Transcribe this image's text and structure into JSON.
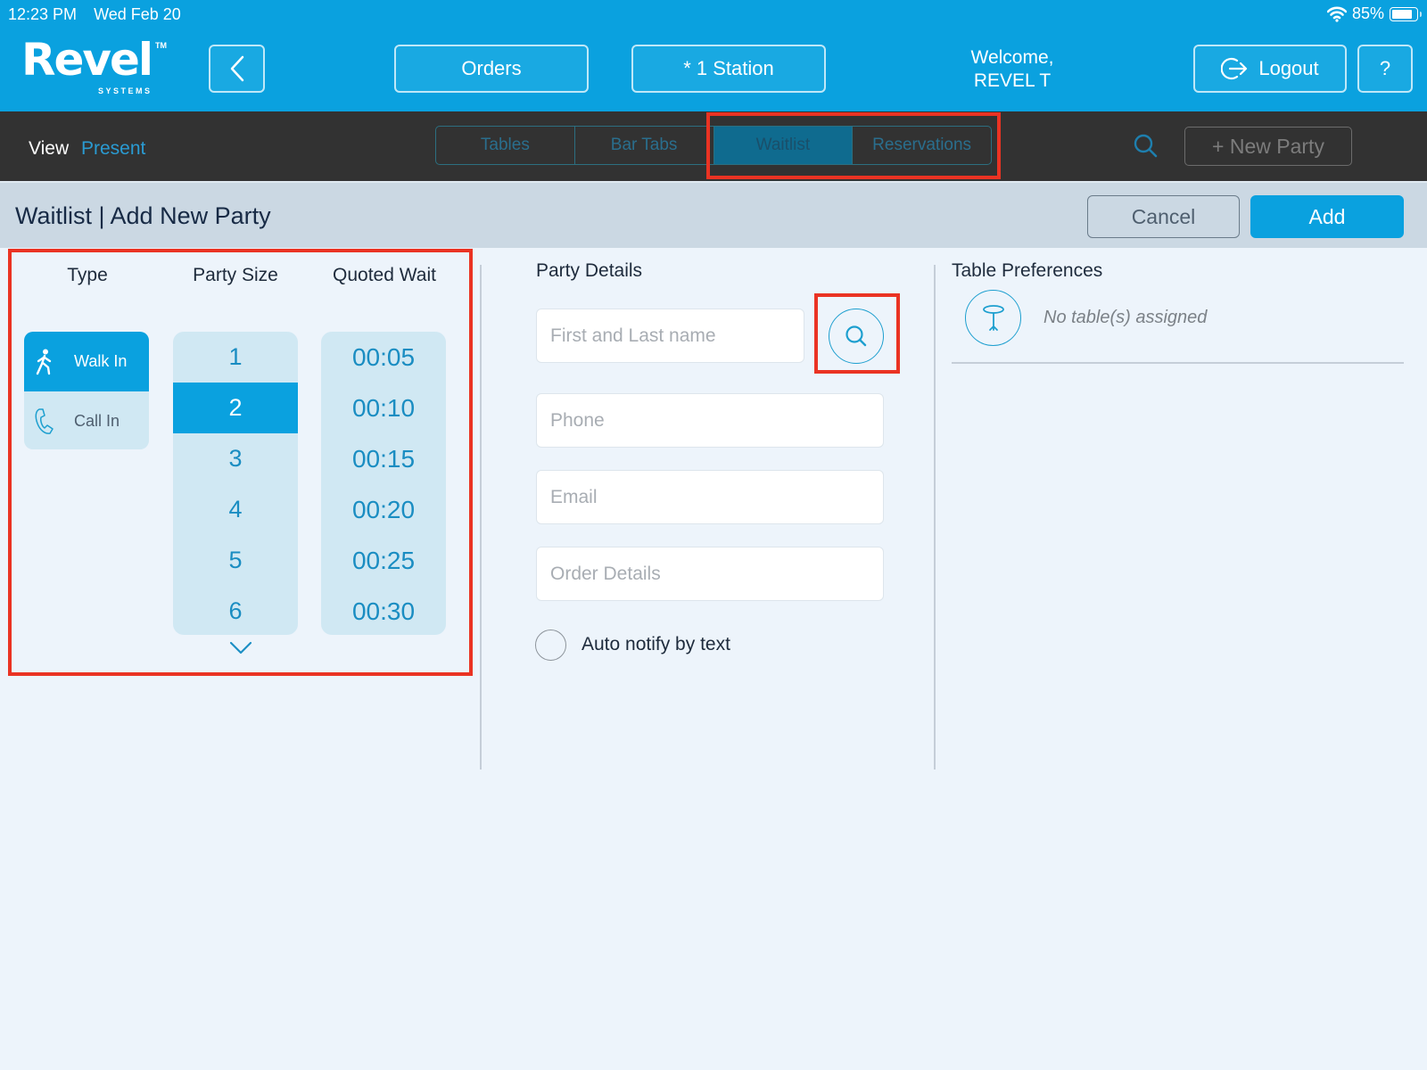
{
  "status_bar": {
    "time": "12:23 PM",
    "date": "Wed Feb 20",
    "wifi_icon": "wifi-icon",
    "battery_percent_label": "85%",
    "battery_level": 0.85
  },
  "header": {
    "logo_word": "Revel",
    "logo_tm": "TM",
    "logo_sub": "SYSTEMS",
    "back_icon": "chevron-left-icon",
    "orders_label": "Orders",
    "station_label": "* 1 Station",
    "welcome_line1": "Welcome,",
    "welcome_line2": "REVEL T",
    "logout_label": "Logout",
    "logout_icon": "logout-arrow-icon",
    "help_label": "?"
  },
  "navbar": {
    "view_label": "View",
    "view_value": "Present",
    "tabs": [
      {
        "label": "Tables",
        "active": false
      },
      {
        "label": "Bar Tabs",
        "active": false
      },
      {
        "label": "Waitlist",
        "active": true
      },
      {
        "label": "Reservations",
        "active": false
      }
    ],
    "search_icon": "search-icon",
    "new_party_label": "+ New Party"
  },
  "titlebar": {
    "title": "Waitlist | Add New Party",
    "cancel_label": "Cancel",
    "add_label": "Add"
  },
  "selectors": {
    "type_header": "Type",
    "party_size_header": "Party Size",
    "quoted_wait_header": "Quoted Wait",
    "types": [
      {
        "label": "Walk In",
        "icon": "walking-person-icon",
        "active": true
      },
      {
        "label": "Call In",
        "icon": "phone-icon",
        "active": false
      }
    ],
    "party_sizes": [
      "1",
      "2",
      "3",
      "4",
      "5",
      "6"
    ],
    "party_size_selected": "2",
    "quoted_waits": [
      "00:05",
      "00:10",
      "00:15",
      "00:20",
      "00:25",
      "00:30"
    ],
    "more_icon": "chevron-down-icon"
  },
  "party_details": {
    "header": "Party Details",
    "name_placeholder": "First and Last name",
    "name_value": "",
    "phone_placeholder": "Phone",
    "phone_value": "",
    "email_placeholder": "Email",
    "email_value": "",
    "order_placeholder": "Order Details",
    "order_value": "",
    "auto_notify_label": "Auto notify by text",
    "auto_notify_checked": false
  },
  "table_preferences": {
    "header": "Table Preferences",
    "table_icon": "table-icon",
    "empty_text": "No table(s) assigned"
  },
  "colors": {
    "brand_blue": "#0aa1df",
    "nav_dark": "#323232",
    "highlight_red": "#ea3323"
  }
}
